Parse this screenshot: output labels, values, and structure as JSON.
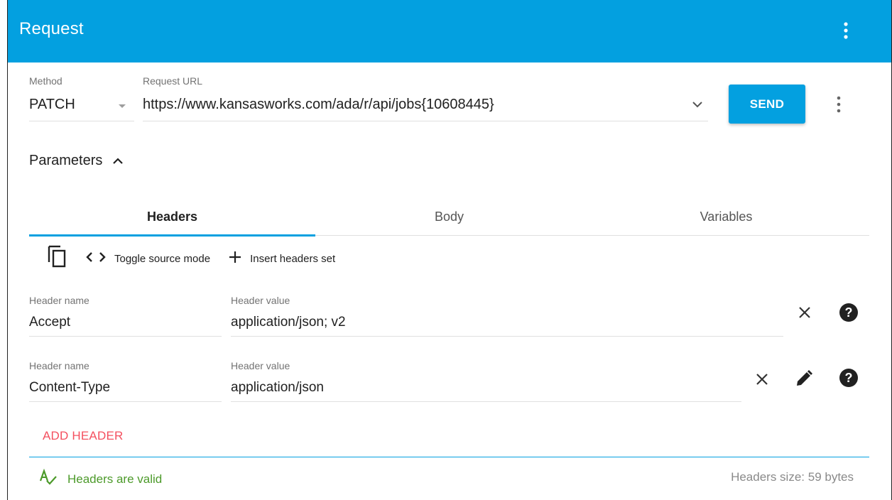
{
  "appbar": {
    "title": "Request"
  },
  "method": {
    "label": "Method",
    "value": "PATCH"
  },
  "url": {
    "label": "Request URL",
    "value": "https://www.kansasworks.com/ada/r/api/jobs{10608445}"
  },
  "send": {
    "label": "SEND"
  },
  "parameters": {
    "label": "Parameters"
  },
  "tabs": [
    {
      "label": "Headers",
      "active": true
    },
    {
      "label": "Body",
      "active": false
    },
    {
      "label": "Variables",
      "active": false
    }
  ],
  "toolbar": {
    "toggle_label": "Toggle source mode",
    "insert_label": "Insert headers set"
  },
  "headers": [
    {
      "name_label": "Header name",
      "name": "Accept",
      "value_label": "Header value",
      "value": "application/json; v2"
    },
    {
      "name_label": "Header name",
      "name": "Content-Type",
      "value_label": "Header value",
      "value": "application/json"
    }
  ],
  "add_header": {
    "label": "ADD HEADER"
  },
  "status": {
    "valid_text": "Headers are valid",
    "size_text": "Headers size: 59 bytes"
  },
  "colors": {
    "accent": "#03a0e0",
    "add": "#f4505f",
    "valid": "#4c9a2a"
  },
  "icons": [
    "more-vert-icon",
    "chevron-down-icon",
    "chevron-up-icon",
    "copy-icon",
    "code-icon",
    "plus-icon",
    "close-icon",
    "help-icon",
    "pencil-icon",
    "spellcheck-icon"
  ]
}
